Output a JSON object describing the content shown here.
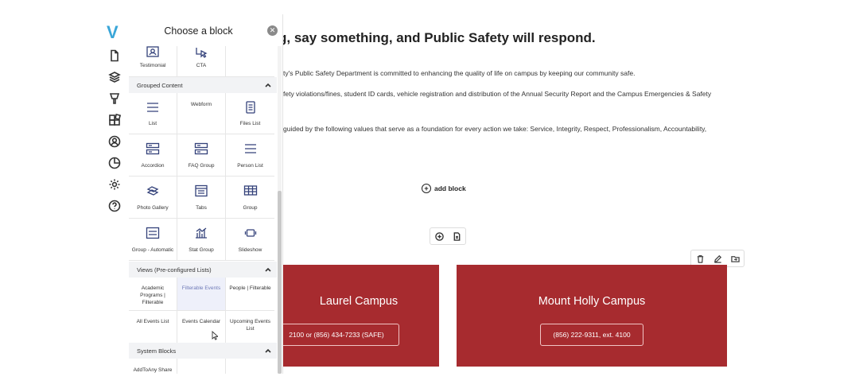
{
  "app": {
    "logo_letter": "V"
  },
  "sidebar_icons": [
    "file-icon",
    "layers-icon",
    "brush-icon",
    "blocks-icon",
    "user-icon",
    "chart-icon",
    "gear-icon",
    "help-icon"
  ],
  "panel": {
    "title": "Choose a block",
    "close_label": "✕",
    "top_row": [
      {
        "label": "Testimonial",
        "icon": "testimonial-icon"
      },
      {
        "label": "CTA",
        "icon": "cta-icon"
      },
      {
        "label": "",
        "icon": ""
      }
    ],
    "sections": [
      {
        "title": "Grouped Content",
        "rows": [
          [
            {
              "label": "List",
              "icon": "list-icon"
            },
            {
              "label": "Webform",
              "icon": ""
            },
            {
              "label": "Files List",
              "icon": "files-list-icon"
            }
          ],
          [
            {
              "label": "Accordion",
              "icon": "accordion-icon"
            },
            {
              "label": "FAQ Group",
              "icon": "faq-group-icon"
            },
            {
              "label": "Person List",
              "icon": "person-list-icon"
            }
          ],
          [
            {
              "label": "Photo Gallery",
              "icon": "photo-gallery-icon"
            },
            {
              "label": "Tabs",
              "icon": "tabs-icon"
            },
            {
              "label": "Group",
              "icon": "group-icon"
            }
          ],
          [
            {
              "label": "Group - Automatic",
              "icon": "group-automatic-icon"
            },
            {
              "label": "Stat Group",
              "icon": "stat-group-icon"
            },
            {
              "label": "Slideshow",
              "icon": "slideshow-icon"
            }
          ]
        ]
      },
      {
        "title": "Views (Pre-configured Lists)",
        "rows": [
          [
            {
              "label": "Academic Programs | Filterable",
              "icon": ""
            },
            {
              "label": "Filterable Events",
              "icon": ""
            },
            {
              "label": "People | Filterable",
              "icon": ""
            }
          ],
          [
            {
              "label": "All Events List",
              "icon": ""
            },
            {
              "label": "Events Calendar",
              "icon": ""
            },
            {
              "label": "Upcoming Events List",
              "icon": ""
            }
          ]
        ]
      },
      {
        "title": "System Blocks",
        "rows": [
          [
            {
              "label": "AddToAny Share",
              "icon": ""
            },
            {
              "label": "",
              "icon": ""
            },
            {
              "label": "",
              "icon": ""
            }
          ]
        ]
      }
    ]
  },
  "page": {
    "headline": "g, say something, and Public Safety will respond.",
    "paragraphs": [
      "ty's Public Safety Department is committed to enhancing the quality of life on campus by keeping our community safe.",
      "fety violations/fines, student ID cards, vehicle registration and distribution of the Annual Security Report and the Campus Emergencies & Safety",
      "guided by the following values that serve as a foundation for every action we take: Service, Integrity, Respect, Professionalism, Accountability,"
    ],
    "add_block_label": "add block",
    "campuses": [
      {
        "title": "Laurel Campus",
        "phone": "2100 or (856) 434-7233 (SAFE)"
      },
      {
        "title": "Mount Holly Campus",
        "phone": "(856) 222-9311, ext. 4100"
      }
    ]
  },
  "colors": {
    "campus_bg": "#a72b2f",
    "icon_stroke": "#34427a",
    "selected_bg": "#eef0fa",
    "logo": "#3aa6d8"
  }
}
